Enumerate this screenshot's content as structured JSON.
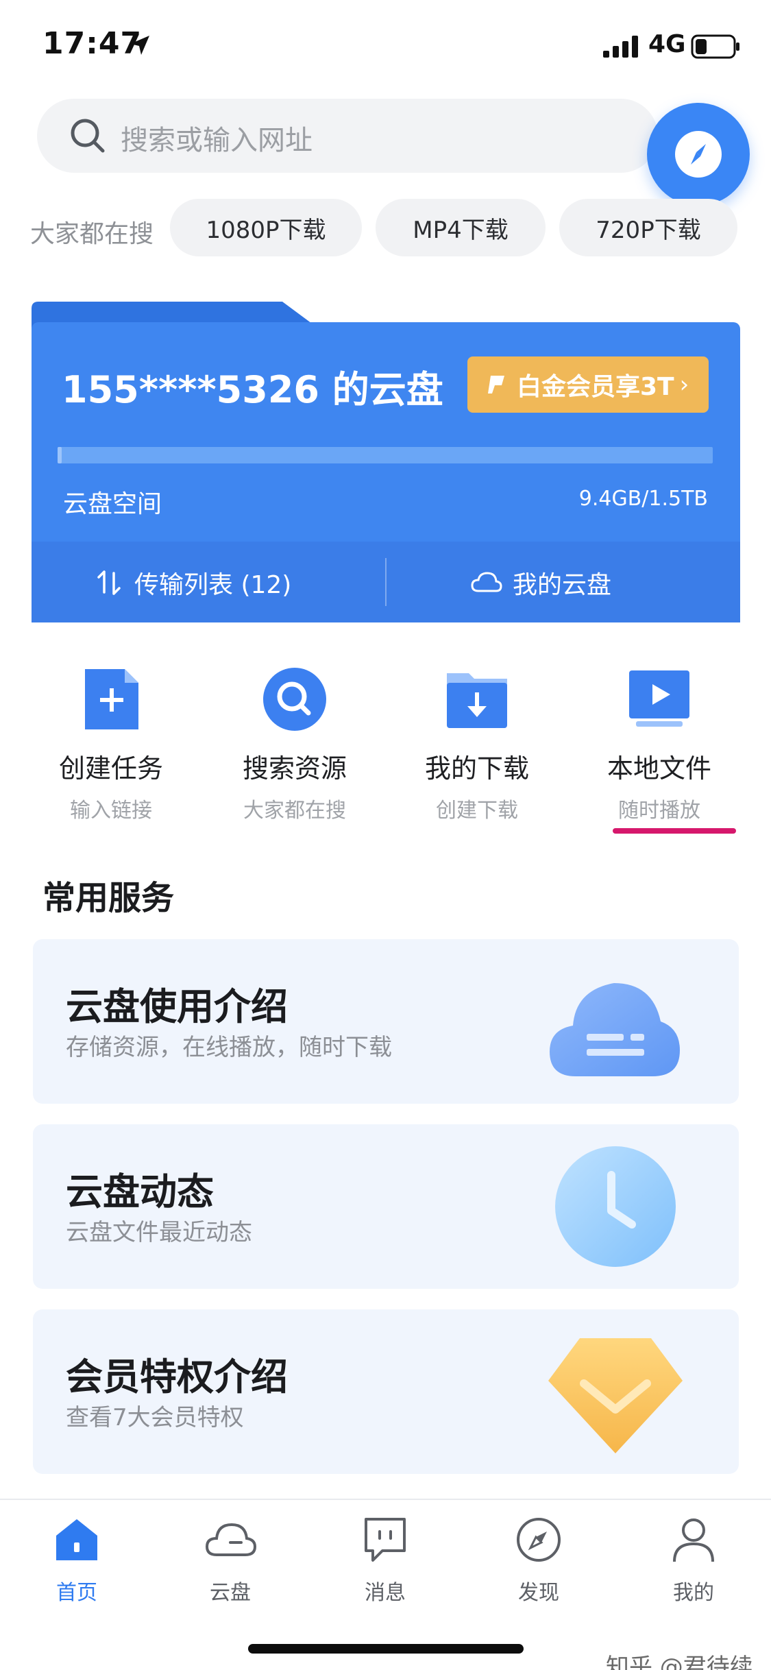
{
  "status_bar": {
    "time": "17:47",
    "network": "4G"
  },
  "search": {
    "placeholder": "搜索或输入网址",
    "hot_label": "大家都在搜",
    "chips": [
      "1080P下载",
      "MP4下载",
      "720P下载"
    ]
  },
  "cloud_card": {
    "title": "155****5326 的云盘",
    "vip_button": "白金会员享3T",
    "space_label": "云盘空间",
    "space_value": "9.4GB/1.5TB",
    "usage_fraction": 0.006,
    "transfer_label": "传输列表 (12)",
    "my_cloud_label": "我的云盘"
  },
  "quick_actions": [
    {
      "title": "创建任务",
      "subtitle": "输入链接",
      "icon": "create-task-icon"
    },
    {
      "title": "搜索资源",
      "subtitle": "大家都在搜",
      "icon": "search-resource-icon"
    },
    {
      "title": "我的下载",
      "subtitle": "创建下载",
      "icon": "download-folder-icon"
    },
    {
      "title": "本地文件",
      "subtitle": "随时播放",
      "icon": "local-video-icon"
    }
  ],
  "services": {
    "section_title": "常用服务",
    "items": [
      {
        "title": "云盘使用介绍",
        "subtitle": "存储资源，在线播放，随时下载",
        "icon": "cloud-icon"
      },
      {
        "title": "云盘动态",
        "subtitle": "云盘文件最近动态",
        "icon": "clock-icon"
      },
      {
        "title": "会员特权介绍",
        "subtitle": "查看7大会员特权",
        "icon": "diamond-icon"
      }
    ]
  },
  "tabbar": {
    "tabs": [
      {
        "label": "首页",
        "icon": "home-icon",
        "active": true
      },
      {
        "label": "云盘",
        "icon": "cloud-tab-icon",
        "active": false
      },
      {
        "label": "消息",
        "icon": "message-icon",
        "active": false
      },
      {
        "label": "发现",
        "icon": "compass-icon",
        "active": false
      },
      {
        "label": "我的",
        "icon": "profile-icon",
        "active": false
      }
    ]
  },
  "watermark": "知乎 @君待续",
  "colors": {
    "primary": "#3f86f0",
    "vip": "#f0b858",
    "accent_pink": "#d6186c"
  }
}
